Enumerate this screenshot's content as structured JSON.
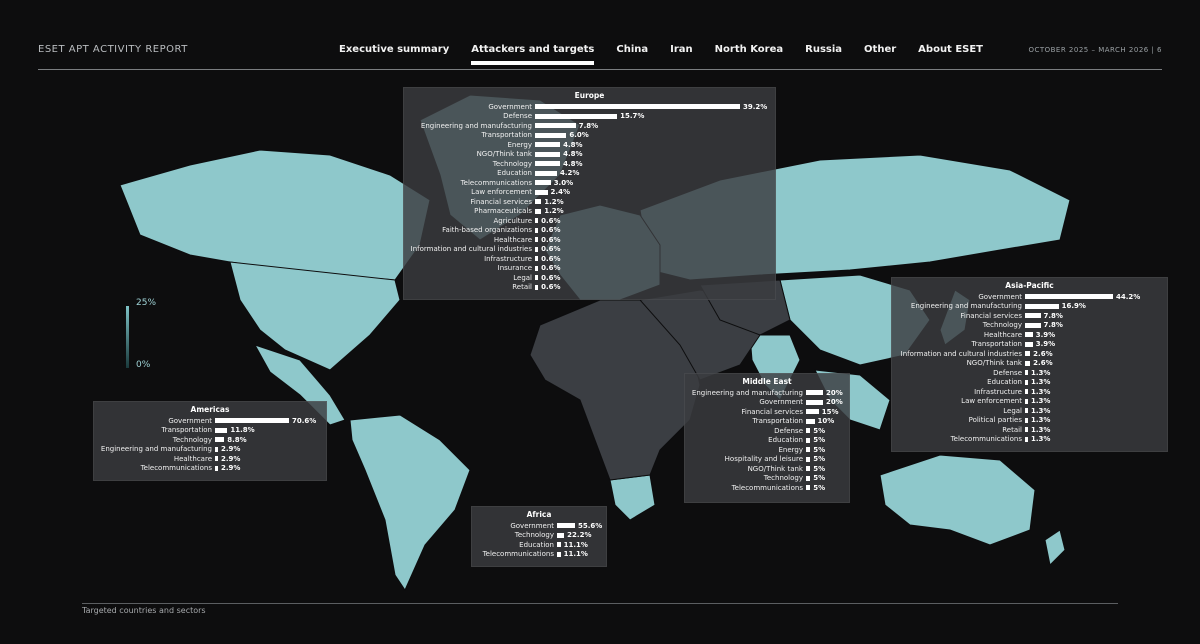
{
  "header": {
    "title": "ESET APT ACTIVITY REPORT",
    "period": "OCTOBER 2025 – MARCH 2026 | 6"
  },
  "nav": [
    {
      "label": "Executive summary",
      "active": false
    },
    {
      "label": "Attackers and targets",
      "active": true
    },
    {
      "label": "China",
      "active": false
    },
    {
      "label": "Iran",
      "active": false
    },
    {
      "label": "North Korea",
      "active": false
    },
    {
      "label": "Russia",
      "active": false
    },
    {
      "label": "Other",
      "active": false
    },
    {
      "label": "About ESET",
      "active": false
    }
  ],
  "legend": {
    "max": "25%",
    "min": "0%"
  },
  "footer": {
    "caption": "Targeted countries and sectors"
  },
  "colors": {
    "land_high": "#8ec8cb",
    "land_low": "#3b3e43",
    "background": "#0d0d0e",
    "panel": "#3a3c40"
  },
  "chart_data": [
    {
      "type": "bar",
      "title": "Europe",
      "categories": [
        "Government",
        "Defense",
        "Engineering and manufacturing",
        "Transportation",
        "Energy",
        "NGO/Think tank",
        "Technology",
        "Education",
        "Telecommunications",
        "Law enforcement",
        "Financial services",
        "Pharmaceuticals",
        "Agriculture",
        "Faith-based organizations",
        "Healthcare",
        "Information and cultural industries",
        "Infrastructure",
        "Insurance",
        "Legal",
        "Retail"
      ],
      "values": [
        39.2,
        15.7,
        7.8,
        6.0,
        4.8,
        4.8,
        4.8,
        4.2,
        3.0,
        2.4,
        1.2,
        1.2,
        0.6,
        0.6,
        0.6,
        0.6,
        0.6,
        0.6,
        0.6,
        0.6
      ],
      "labels": [
        "39.2%",
        "15.7%",
        "7.8%",
        "6.0%",
        "4.8%",
        "4.8%",
        "4.8%",
        "4.2%",
        "3.0%",
        "2.4%",
        "1.2%",
        "1.2%",
        "0.6%",
        "0.6%",
        "0.6%",
        "0.6%",
        "0.6%",
        "0.6%",
        "0.6%",
        "0.6%"
      ]
    },
    {
      "type": "bar",
      "title": "Asia-Pacific",
      "categories": [
        "Government",
        "Engineering and manufacturing",
        "Financial services",
        "Technology",
        "Healthcare",
        "Transportation",
        "Information and cultural industries",
        "NGO/Think tank",
        "Defense",
        "Education",
        "Infrastructure",
        "Law enforcement",
        "Legal",
        "Political parties",
        "Retail",
        "Telecommunications"
      ],
      "values": [
        44.2,
        16.9,
        7.8,
        7.8,
        3.9,
        3.9,
        2.6,
        2.6,
        1.3,
        1.3,
        1.3,
        1.3,
        1.3,
        1.3,
        1.3,
        1.3
      ],
      "labels": [
        "44.2%",
        "16.9%",
        "7.8%",
        "7.8%",
        "3.9%",
        "3.9%",
        "2.6%",
        "2.6%",
        "1.3%",
        "1.3%",
        "1.3%",
        "1.3%",
        "1.3%",
        "1.3%",
        "1.3%",
        "1.3%"
      ]
    },
    {
      "type": "bar",
      "title": "Americas",
      "categories": [
        "Government",
        "Transportation",
        "Technology",
        "Engineering and manufacturing",
        "Healthcare",
        "Telecommunications"
      ],
      "values": [
        70.6,
        11.8,
        8.8,
        2.9,
        2.9,
        2.9
      ],
      "labels": [
        "70.6%",
        "11.8%",
        "8.8%",
        "2.9%",
        "2.9%",
        "2.9%"
      ]
    },
    {
      "type": "bar",
      "title": "Middle East",
      "categories": [
        "Engineering and manufacturing",
        "Government",
        "Financial services",
        "Transportation",
        "Defense",
        "Education",
        "Energy",
        "Hospitality and leisure",
        "NGO/Think tank",
        "Technology",
        "Telecommunications"
      ],
      "values": [
        20,
        20,
        15,
        10,
        5,
        5,
        5,
        5,
        5,
        5,
        5
      ],
      "labels": [
        "20%",
        "20%",
        "15%",
        "10%",
        "5%",
        "5%",
        "5%",
        "5%",
        "5%",
        "5%",
        "5%"
      ]
    },
    {
      "type": "bar",
      "title": "Africa",
      "categories": [
        "Government",
        "Technology",
        "Education",
        "Telecommunications"
      ],
      "values": [
        55.6,
        22.2,
        11.1,
        11.1
      ],
      "labels": [
        "55.6%",
        "22.2%",
        "11.1%",
        "11.1%"
      ]
    }
  ]
}
